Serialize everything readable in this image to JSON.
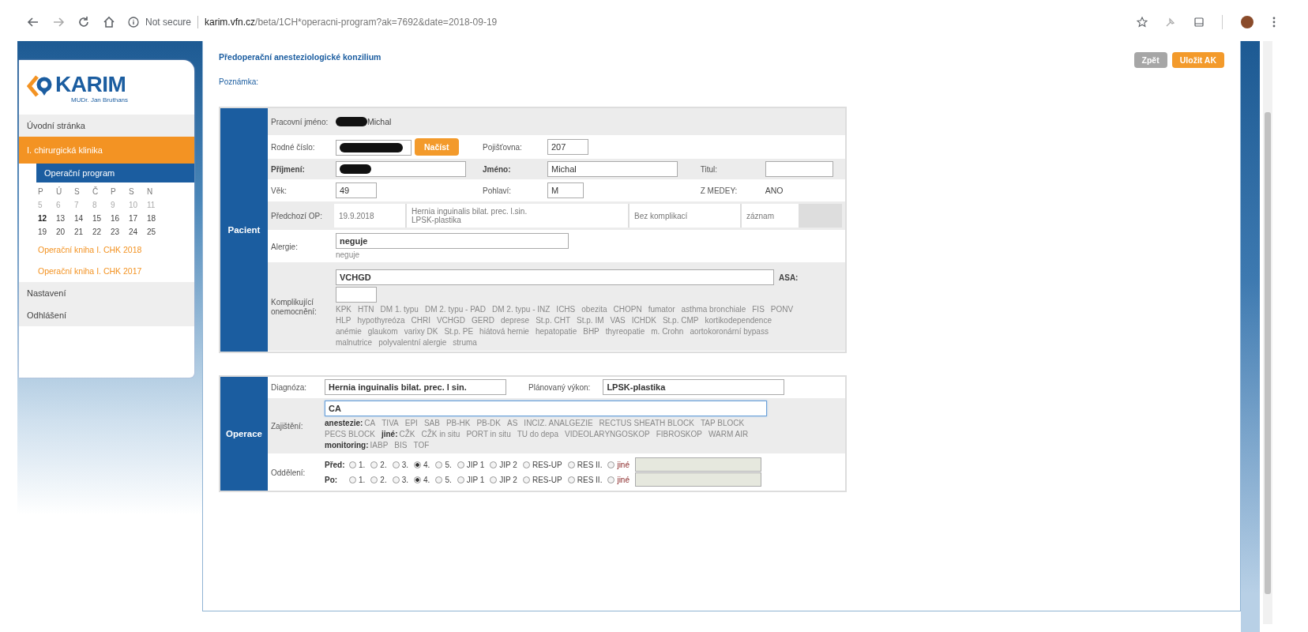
{
  "browser": {
    "security": "Not secure",
    "url_host": "karim.vfn.cz",
    "url_path": "/beta/1CH*operacni-program?ak=7692&date=2018-09-19"
  },
  "sidebar": {
    "logo": {
      "name": "KARIM",
      "subtitle": "MUDr. Jan Bruthans"
    },
    "menu": [
      {
        "label": "Úvodní stránka",
        "selected": false
      },
      {
        "label": "I. chirurgická klinika",
        "selected": true,
        "children": [
          {
            "label": "Operační program",
            "selected": true
          }
        ]
      }
    ],
    "calendar": {
      "weekdays": [
        "P",
        "Ú",
        "S",
        "Č",
        "P",
        "S",
        "N"
      ],
      "weeks": [
        {
          "muted": true,
          "days": [
            {
              "day": "5",
              "today": false
            },
            {
              "day": "6",
              "today": false
            },
            {
              "day": "7",
              "today": false
            },
            {
              "day": "8",
              "today": false
            },
            {
              "day": "9",
              "today": false
            },
            {
              "day": "10",
              "today": false
            },
            {
              "day": "11",
              "today": false
            }
          ]
        },
        {
          "muted": false,
          "days": [
            {
              "day": "12",
              "today": true
            },
            {
              "day": "13",
              "today": false
            },
            {
              "day": "14",
              "today": false
            },
            {
              "day": "15",
              "today": false
            },
            {
              "day": "16",
              "today": false
            },
            {
              "day": "17",
              "today": false
            },
            {
              "day": "18",
              "today": false
            }
          ]
        },
        {
          "muted": false,
          "days": [
            {
              "day": "19",
              "today": false
            },
            {
              "day": "20",
              "today": false
            },
            {
              "day": "21",
              "today": false
            },
            {
              "day": "22",
              "today": false
            },
            {
              "day": "23",
              "today": false
            },
            {
              "day": "24",
              "today": false
            },
            {
              "day": "25",
              "today": false
            }
          ]
        }
      ]
    },
    "book_links": [
      "Operační kniha I. CHK 2018",
      "Operační kniha I. CHK 2017"
    ],
    "menu_bottom": [
      {
        "label": "Nastavení",
        "selected": false
      },
      {
        "label": "Odhlášení",
        "selected": false
      }
    ]
  },
  "page": {
    "title": "Předoperační anesteziologické konzilium",
    "note_label": "Poznámka:",
    "buttons": [
      {
        "label": "Zpět",
        "kind": "secondary"
      },
      {
        "label": "Uložit AK",
        "kind": "primary"
      }
    ]
  },
  "patient": {
    "heading": "Pacient",
    "working_name": {
      "label": "Pracovní jméno:",
      "value": "Michal",
      "redacted": true
    },
    "birth_number": {
      "label": "Rodné číslo:",
      "redacted": true,
      "button": "Načíst"
    },
    "insurance": {
      "label": "Pojišťovna:",
      "value": "207"
    },
    "surname": {
      "label": "Příjmení:",
      "redacted": true,
      "emphasis": true
    },
    "first_name": {
      "label": "Jméno:",
      "value": "Michal",
      "emphasis": true
    },
    "title": {
      "label": "Titul:"
    },
    "age": {
      "label": "Věk:",
      "value": "49"
    },
    "sex": {
      "label": "Pohlaví:",
      "value": "M"
    },
    "medey": {
      "label": "Z MEDEY:",
      "value": "ANO"
    },
    "previous_op": {
      "label": "Předchozí OP:",
      "date": "19.9.2018",
      "diagnosis": "Hernia inguinalis bilat. prec. l.sin.",
      "procedure": "LPSK-plastika",
      "outcome": "Bez komplikací",
      "record": "záznam"
    },
    "allergy": {
      "label": "Alergie:",
      "value": "neguje",
      "note": "neguje"
    },
    "comorbidities": {
      "label": "Komplikující onemocnění:",
      "value": "VCHGD",
      "asa_label": "ASA:",
      "options": [
        "KPK",
        "HTN",
        "DM 1. typu",
        "DM 2. typu - PAD",
        "DM 2. typu - INZ",
        "ICHS",
        "obezita",
        "CHOPN",
        "fumator",
        "asthma bronchiale",
        "FIS",
        "PONV",
        "HLP",
        "hypothyreóza",
        "CHRI",
        "VCHGD",
        "GERD",
        "deprese",
        "St.p. CHT",
        "St.p. IM",
        "VAS",
        "ICHDK",
        "St.p. CMP",
        "kortikodependence",
        "anémie",
        "glaukom",
        "varixy DK",
        "St.p. PE",
        "hiátová hernie",
        "hepatopatie",
        "BHP",
        "thyreopatie",
        "m. Crohn",
        "aortokoronární bypass",
        "malnutrice",
        "polyvalentní alergie",
        "struma"
      ]
    }
  },
  "operation": {
    "heading": "Operace",
    "diagnosis": {
      "label": "Diagnóza:",
      "value": "Hernia inguinalis bilat. prec. l sin."
    },
    "planned": {
      "label": "Plánovaný výkon:",
      "value": "LPSK-plastika"
    },
    "access": {
      "label": "Zajištění:",
      "value": "CA",
      "focused": true,
      "groups": [
        {
          "label": "anestezie:",
          "options": [
            "CA",
            "TIVA",
            "EPI",
            "SAB",
            "PB-HK",
            "PB-DK",
            "AS",
            "INCIZ. ANALGEZIE",
            "RECTUS SHEATH BLOCK",
            "TAP BLOCK",
            "PECS BLOCK"
          ]
        },
        {
          "label": "jiné:",
          "options": [
            "CŽK",
            "CŽK in situ",
            "PORT in situ",
            "TU do depa",
            "VIDEOLARYNGOSKOP",
            "FIBROSKOP",
            "WARM AIR"
          ]
        },
        {
          "label": "monitoring:",
          "options": [
            "IABP",
            "BIS",
            "TOF"
          ]
        }
      ]
    },
    "ward": {
      "label": "Oddělení:",
      "rows": [
        {
          "label": "Před:",
          "options": [
            {
              "label": "1.",
              "selected": false,
              "kind": "plain"
            },
            {
              "label": "2.",
              "selected": false,
              "kind": "plain"
            },
            {
              "label": "3.",
              "selected": false,
              "kind": "plain"
            },
            {
              "label": "4.",
              "selected": true,
              "kind": "plain"
            },
            {
              "label": "5.",
              "selected": false,
              "kind": "plain"
            },
            {
              "label": "JIP 1",
              "selected": false,
              "kind": "plain"
            },
            {
              "label": "JIP 2",
              "selected": false,
              "kind": "plain"
            },
            {
              "label": "RES-UP",
              "selected": false,
              "kind": "plain"
            },
            {
              "label": "RES II.",
              "selected": false,
              "kind": "plain"
            },
            {
              "label": "jiné",
              "selected": false,
              "kind": "other"
            }
          ]
        },
        {
          "label": "Po:",
          "options": [
            {
              "label": "1.",
              "selected": false,
              "kind": "plain"
            },
            {
              "label": "2.",
              "selected": false,
              "kind": "plain"
            },
            {
              "label": "3.",
              "selected": false,
              "kind": "plain"
            },
            {
              "label": "4.",
              "selected": true,
              "kind": "plain"
            },
            {
              "label": "5.",
              "selected": false,
              "kind": "plain"
            },
            {
              "label": "JIP 1",
              "selected": false,
              "kind": "plain"
            },
            {
              "label": "JIP 2",
              "selected": false,
              "kind": "plain"
            },
            {
              "label": "RES-UP",
              "selected": false,
              "kind": "plain"
            },
            {
              "label": "RES II.",
              "selected": false,
              "kind": "plain"
            },
            {
              "label": "jiné",
              "selected": false,
              "kind": "other"
            }
          ]
        }
      ]
    }
  }
}
